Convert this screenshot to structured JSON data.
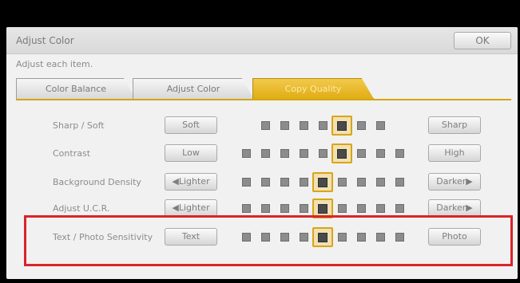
{
  "window": {
    "title": "Adjust Color",
    "ok_label": "OK",
    "instruction": "Adjust each item."
  },
  "tabs": [
    {
      "label": "Color Balance",
      "active": false
    },
    {
      "label": "Adjust Color",
      "active": false
    },
    {
      "label": "Copy Quality",
      "active": true
    }
  ],
  "rows": [
    {
      "label": "Sharp / Soft",
      "left_label": "Soft",
      "right_label": "Sharp",
      "steps": 7,
      "level": 4
    },
    {
      "label": "Contrast",
      "left_label": "Low",
      "right_label": "High",
      "steps": 9,
      "level": 5
    },
    {
      "label": "Background Density",
      "left_label": "◀Lighter",
      "right_label": "Darker▶",
      "steps": 9,
      "level": 4
    },
    {
      "label": "Adjust U.C.R.",
      "left_label": "◀Lighter",
      "right_label": "Darker▶",
      "steps": 9,
      "level": 4
    },
    {
      "label": "Text / Photo Sensitivity",
      "left_label": "Text",
      "right_label": "Photo",
      "steps": 9,
      "level": 4
    }
  ],
  "colors": {
    "accent": "#e0ad12",
    "highlight_border": "#d9242a"
  }
}
